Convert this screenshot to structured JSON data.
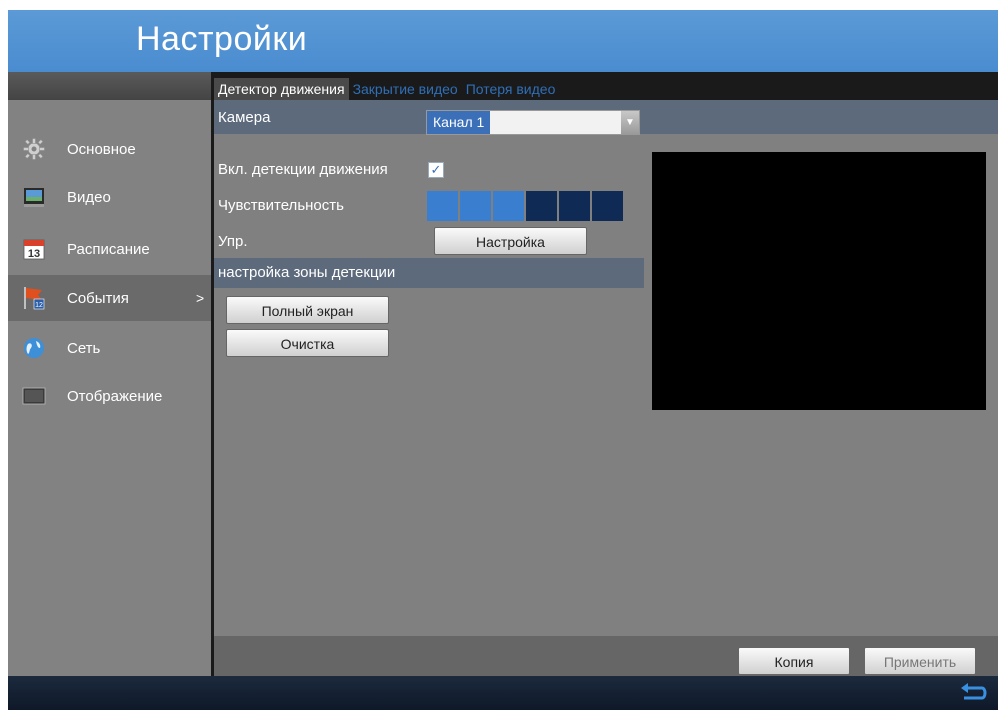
{
  "title": "Настройки",
  "tabs": [
    {
      "label": "Детектор движения",
      "active": true
    },
    {
      "label": "Закрытие видео",
      "active": false
    },
    {
      "label": "Потеря видео",
      "active": false
    }
  ],
  "sidebar": {
    "items": [
      {
        "label": "Основное",
        "icon": "gear-icon"
      },
      {
        "label": "Видео",
        "icon": "video-icon"
      },
      {
        "label": "Расписание",
        "icon": "calendar-icon"
      },
      {
        "label": "События",
        "icon": "events-flag-icon",
        "arrow": ">",
        "selected": true
      },
      {
        "label": "Сеть",
        "icon": "network-globe-icon"
      },
      {
        "label": "Отображение",
        "icon": "display-icon"
      }
    ]
  },
  "form": {
    "camera_label": "Камера",
    "camera_value": "Канал 1",
    "motion_enable_label": "Вкл. детекции движения",
    "motion_enable_checked": true,
    "check_mark": "✓",
    "sensitivity_label": "Чувствительность",
    "sensitivity": {
      "level": 3,
      "max": 6
    },
    "handling_label": "Упр.",
    "setup_button": "Настройка",
    "zone_header": "настройка зоны детекции",
    "fullscreen_button": "Полный экран",
    "clear_button": "Очистка"
  },
  "footer": {
    "copy_button": "Копия",
    "apply_button": "Применить"
  },
  "colors": {
    "accent": "#4a8cd0",
    "sensitivity_on": "#3a7fcf",
    "sensitivity_off": "#0e2a55"
  }
}
